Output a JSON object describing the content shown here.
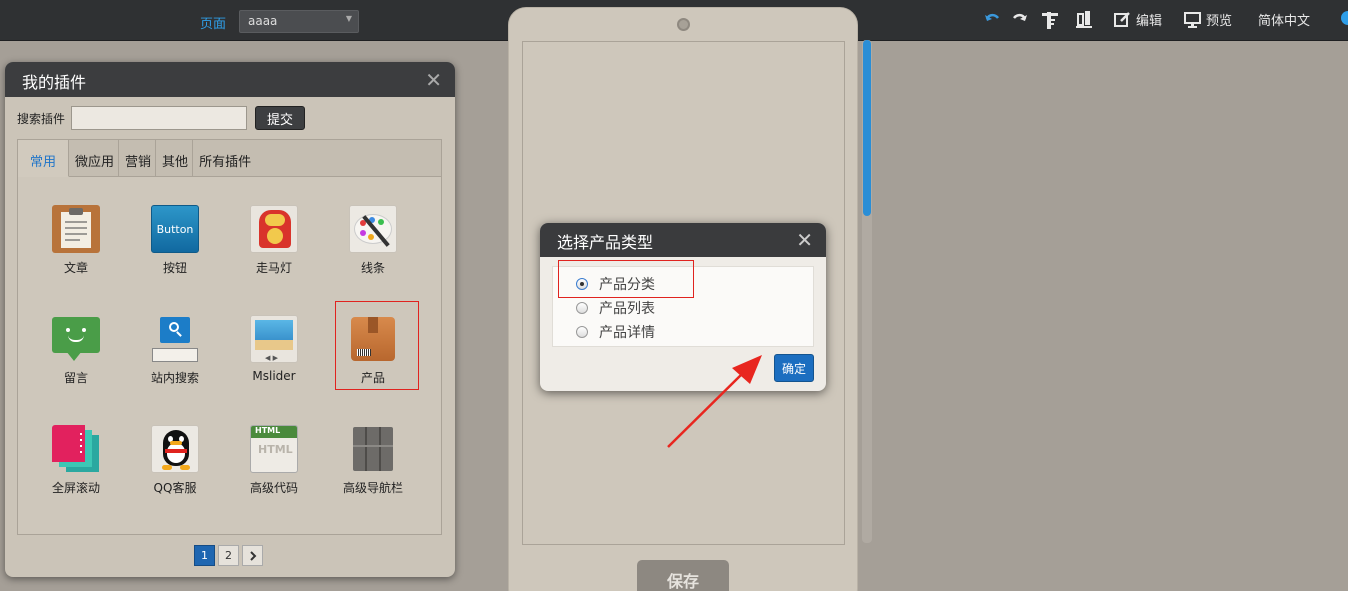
{
  "topbar": {
    "page_label": "页面",
    "page_select_value": "aaaa",
    "tools": {
      "undo_icon": "undo-icon",
      "redo_icon": "redo-icon",
      "ruler_icon": "ruler-icon",
      "layout_icon": "layout-icon",
      "edit_label": "编辑",
      "preview_label": "预览",
      "language_label": "简体中文"
    }
  },
  "plugin_panel": {
    "title": "我的插件",
    "search_label": "搜索插件",
    "search_value": "",
    "submit_label": "提交",
    "tabs": [
      "常用",
      "微应用",
      "营销",
      "其他",
      "所有插件"
    ],
    "active_tab": "常用",
    "plugins": [
      {
        "label": "文章",
        "icon": "clipboard-icon"
      },
      {
        "label": "按钮",
        "icon": "button-icon",
        "icon_text": "Button"
      },
      {
        "label": "走马灯",
        "icon": "carousel-icon"
      },
      {
        "label": "线条",
        "icon": "palette-icon"
      },
      {
        "label": "留言",
        "icon": "message-icon"
      },
      {
        "label": "站内搜索",
        "icon": "search-icon"
      },
      {
        "label": "Mslider",
        "icon": "slider-icon"
      },
      {
        "label": "产品",
        "icon": "product-box-icon"
      },
      {
        "label": "全屏滚动",
        "icon": "fullscreen-scroll-icon"
      },
      {
        "label": "QQ客服",
        "icon": "qq-icon"
      },
      {
        "label": "高级代码",
        "icon": "html-code-icon",
        "icon_text": "HTML"
      },
      {
        "label": "高级导航栏",
        "icon": "navbar-icon"
      }
    ],
    "pages": [
      "1",
      "2"
    ],
    "current_page": "1",
    "next_icon": "chevron-right-icon"
  },
  "phone": {
    "save_label": "保存"
  },
  "dialog": {
    "title": "选择产品类型",
    "options": [
      "产品分类",
      "产品列表",
      "产品详情"
    ],
    "selected": "产品分类",
    "confirm_label": "确定"
  },
  "colors": {
    "accent": "#1c6ec0",
    "highlight": "#e0231f",
    "topbar": "#2f3133"
  }
}
